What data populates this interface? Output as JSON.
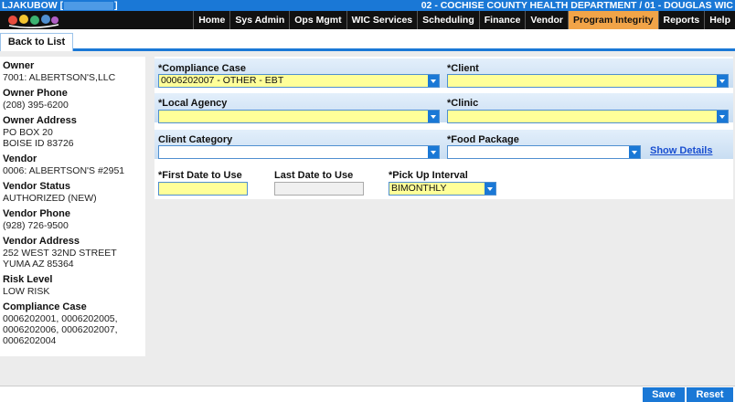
{
  "topbar": {
    "user": "LJAKUBOW [",
    "user_close": "]",
    "department": "02 - COCHISE COUNTY HEALTH DEPARTMENT / 01 - DOUGLAS WIC"
  },
  "logo": {
    "icon": "wic-logo-icon"
  },
  "nav": {
    "items": [
      "Home",
      "Sys Admin",
      "Ops Mgmt",
      "WIC Services",
      "Scheduling",
      "Finance",
      "Vendor",
      "Program Integrity",
      "Reports",
      "Help"
    ],
    "active": "Program Integrity",
    "active_color": "#f1a448"
  },
  "tabs": {
    "back_to_list": "Back to List"
  },
  "vendor_info": {
    "owner_label": "Owner",
    "owner_value": "7001: ALBERTSON'S,LLC",
    "owner_phone_label": "Owner Phone",
    "owner_phone_value": "(208) 395-6200",
    "owner_address_label": "Owner Address",
    "owner_address_value": "PO BOX 20\nBOISE ID 83726",
    "vendor_label": "Vendor",
    "vendor_value": "0006: ALBERTSON'S #2951",
    "vendor_status_label": "Vendor Status",
    "vendor_status_value": "AUTHORIZED (NEW)",
    "vendor_phone_label": "Vendor Phone",
    "vendor_phone_value": "(928) 726-9500",
    "vendor_address_label": "Vendor Address",
    "vendor_address_value": "252 WEST 32ND STREET\nYUMA AZ 85364",
    "risk_level_label": "Risk Level",
    "risk_level_value": "LOW RISK",
    "compliance_case_label": "Compliance Case",
    "compliance_case_value": "0006202001, 0006202005,\n0006202006, 0006202007,\n0006202004"
  },
  "form": {
    "compliance_case_label": "*Compliance Case",
    "compliance_case_value": "0006202007 - OTHER - EBT",
    "client_label": "*Client",
    "client_value": "",
    "local_agency_label": "*Local Agency",
    "local_agency_value": "",
    "clinic_label": "*Clinic",
    "clinic_value": "",
    "client_category_label": "Client Category",
    "client_category_value": "",
    "food_package_label": "*Food Package",
    "food_package_value": "",
    "show_details": "Show Details",
    "first_date_label": "*First Date to Use",
    "first_date_value": "",
    "last_date_label": "Last Date to Use",
    "last_date_value": "",
    "pickup_interval_label": "*Pick Up Interval",
    "pickup_interval_value": "BIMONTHLY",
    "required_color": "#ffff99"
  },
  "actions": {
    "save": "Save",
    "reset": "Reset"
  }
}
